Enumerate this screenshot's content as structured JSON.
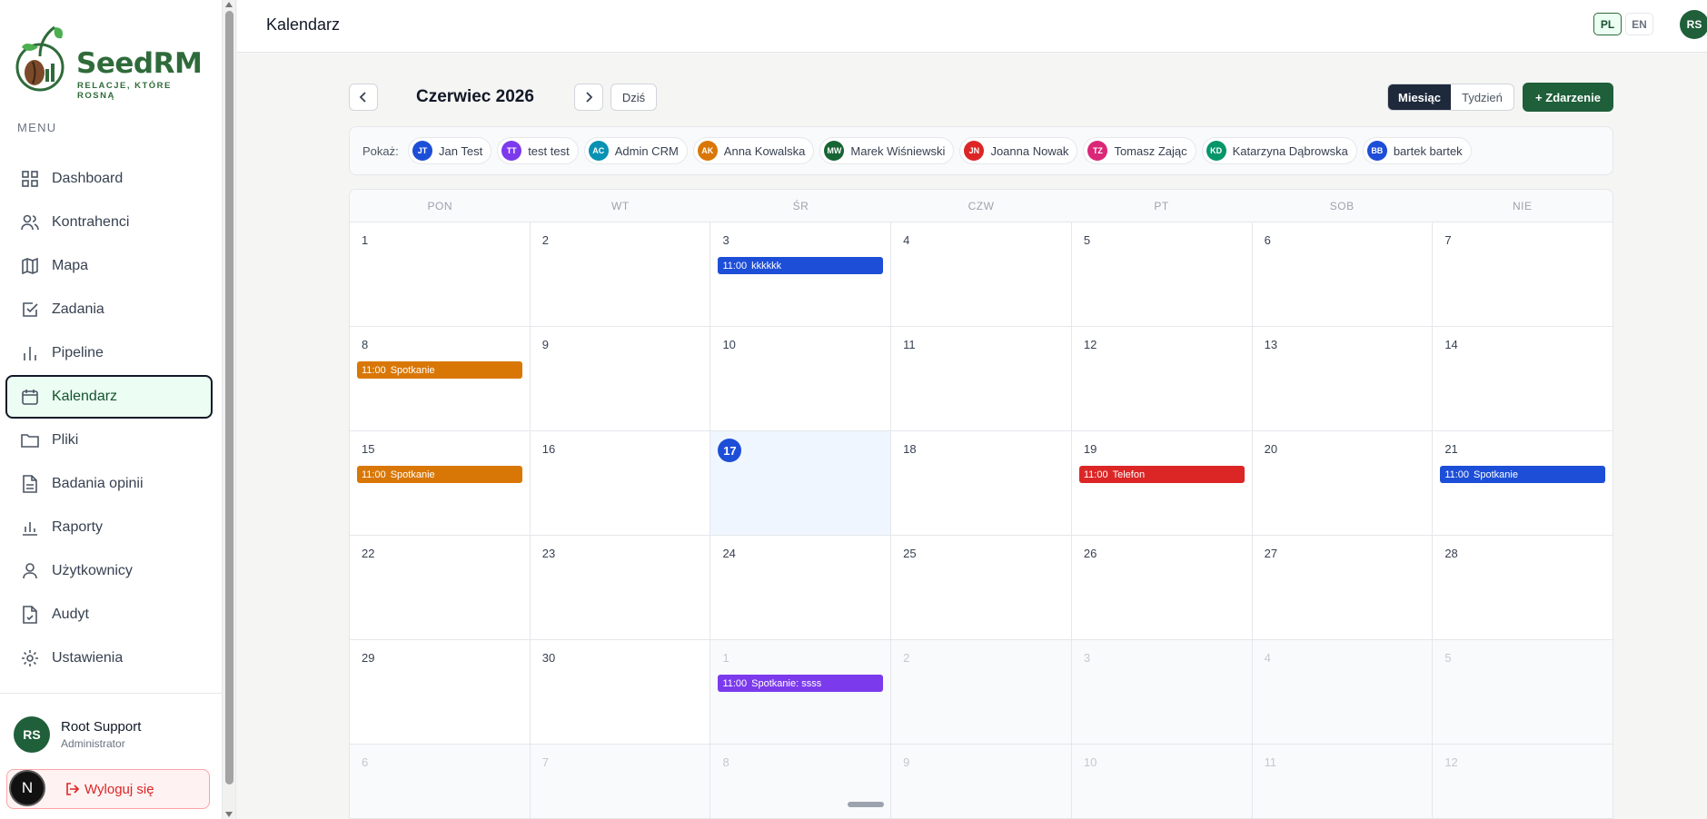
{
  "app": {
    "name": "SeedRM",
    "tagline": "RELACJE, KTÓRE ROSNĄ"
  },
  "sidebar": {
    "menu_label": "MENU",
    "items": [
      {
        "label": "Dashboard",
        "icon": "dashboard-icon"
      },
      {
        "label": "Kontrahenci",
        "icon": "users-icon"
      },
      {
        "label": "Mapa",
        "icon": "map-icon"
      },
      {
        "label": "Zadania",
        "icon": "check-square-icon"
      },
      {
        "label": "Pipeline",
        "icon": "bar-chart-icon"
      },
      {
        "label": "Kalendarz",
        "icon": "calendar-icon",
        "active": true
      },
      {
        "label": "Pliki",
        "icon": "folder-icon"
      },
      {
        "label": "Badania opinii",
        "icon": "file-text-icon"
      },
      {
        "label": "Raporty",
        "icon": "chart-icon"
      },
      {
        "label": "Użytkownicy",
        "icon": "user-icon"
      },
      {
        "label": "Audyt",
        "icon": "file-check-icon"
      },
      {
        "label": "Ustawienia",
        "icon": "gear-icon"
      }
    ],
    "user": {
      "initials": "RS",
      "name": "Root Support",
      "role": "Administrator"
    },
    "logout_label": "Wyloguj się",
    "next_badge": "N"
  },
  "header": {
    "title": "Kalendarz",
    "lang_pl": "PL",
    "lang_en": "EN",
    "avatar": "RS"
  },
  "toolbar": {
    "month_title": "Czerwiec 2026",
    "today_label": "Dziś",
    "view_month": "Miesiąc",
    "view_week": "Tydzień",
    "add_label": "+ Zdarzenie"
  },
  "filters": {
    "label": "Pokaż:",
    "people": [
      {
        "initials": "JT",
        "name": "Jan Test",
        "color": "#1d4ed8"
      },
      {
        "initials": "TT",
        "name": "test test",
        "color": "#7c3aed"
      },
      {
        "initials": "AC",
        "name": "Admin CRM",
        "color": "#0891b2"
      },
      {
        "initials": "AK",
        "name": "Anna Kowalska",
        "color": "#d97706"
      },
      {
        "initials": "MW",
        "name": "Marek Wiśniewski",
        "color": "#166534"
      },
      {
        "initials": "JN",
        "name": "Joanna Nowak",
        "color": "#dc2626"
      },
      {
        "initials": "TZ",
        "name": "Tomasz Zając",
        "color": "#db2777"
      },
      {
        "initials": "KD",
        "name": "Katarzyna Dąbrowska",
        "color": "#059669"
      },
      {
        "initials": "BB",
        "name": "bartek bartek",
        "color": "#1d4ed8"
      }
    ]
  },
  "calendar": {
    "weekdays": [
      "PON",
      "WT",
      "ŚR",
      "CZW",
      "PT",
      "SOB",
      "NIE"
    ],
    "weeks": [
      [
        {
          "d": "1"
        },
        {
          "d": "2"
        },
        {
          "d": "3",
          "event": {
            "time": "11:00",
            "title": "kkkkkk",
            "color": "#1d4ed8"
          }
        },
        {
          "d": "4"
        },
        {
          "d": "5"
        },
        {
          "d": "6"
        },
        {
          "d": "7"
        }
      ],
      [
        {
          "d": "8",
          "event": {
            "time": "11:00",
            "title": "Spotkanie",
            "color": "#d97706"
          }
        },
        {
          "d": "9"
        },
        {
          "d": "10"
        },
        {
          "d": "11"
        },
        {
          "d": "12"
        },
        {
          "d": "13"
        },
        {
          "d": "14"
        }
      ],
      [
        {
          "d": "15",
          "event": {
            "time": "11:00",
            "title": "Spotkanie",
            "color": "#d97706"
          }
        },
        {
          "d": "16"
        },
        {
          "d": "17",
          "today": true
        },
        {
          "d": "18"
        },
        {
          "d": "19",
          "event": {
            "time": "11:00",
            "title": "Telefon",
            "color": "#dc2626"
          }
        },
        {
          "d": "20"
        },
        {
          "d": "21",
          "event": {
            "time": "11:00",
            "title": "Spotkanie",
            "color": "#1d4ed8"
          }
        }
      ],
      [
        {
          "d": "22"
        },
        {
          "d": "23"
        },
        {
          "d": "24"
        },
        {
          "d": "25"
        },
        {
          "d": "26"
        },
        {
          "d": "27"
        },
        {
          "d": "28"
        }
      ],
      [
        {
          "d": "29"
        },
        {
          "d": "30"
        },
        {
          "d": "1",
          "muted": true,
          "event": {
            "time": "11:00",
            "title": "Spotkanie: ssss",
            "color": "#7c3aed"
          }
        },
        {
          "d": "2",
          "muted": true
        },
        {
          "d": "3",
          "muted": true
        },
        {
          "d": "4",
          "muted": true
        },
        {
          "d": "5",
          "muted": true
        }
      ],
      [
        {
          "d": "6",
          "muted": true
        },
        {
          "d": "7",
          "muted": true
        },
        {
          "d": "8",
          "muted": true
        },
        {
          "d": "9",
          "muted": true
        },
        {
          "d": "10",
          "muted": true
        },
        {
          "d": "11",
          "muted": true
        },
        {
          "d": "12",
          "muted": true
        }
      ]
    ]
  }
}
